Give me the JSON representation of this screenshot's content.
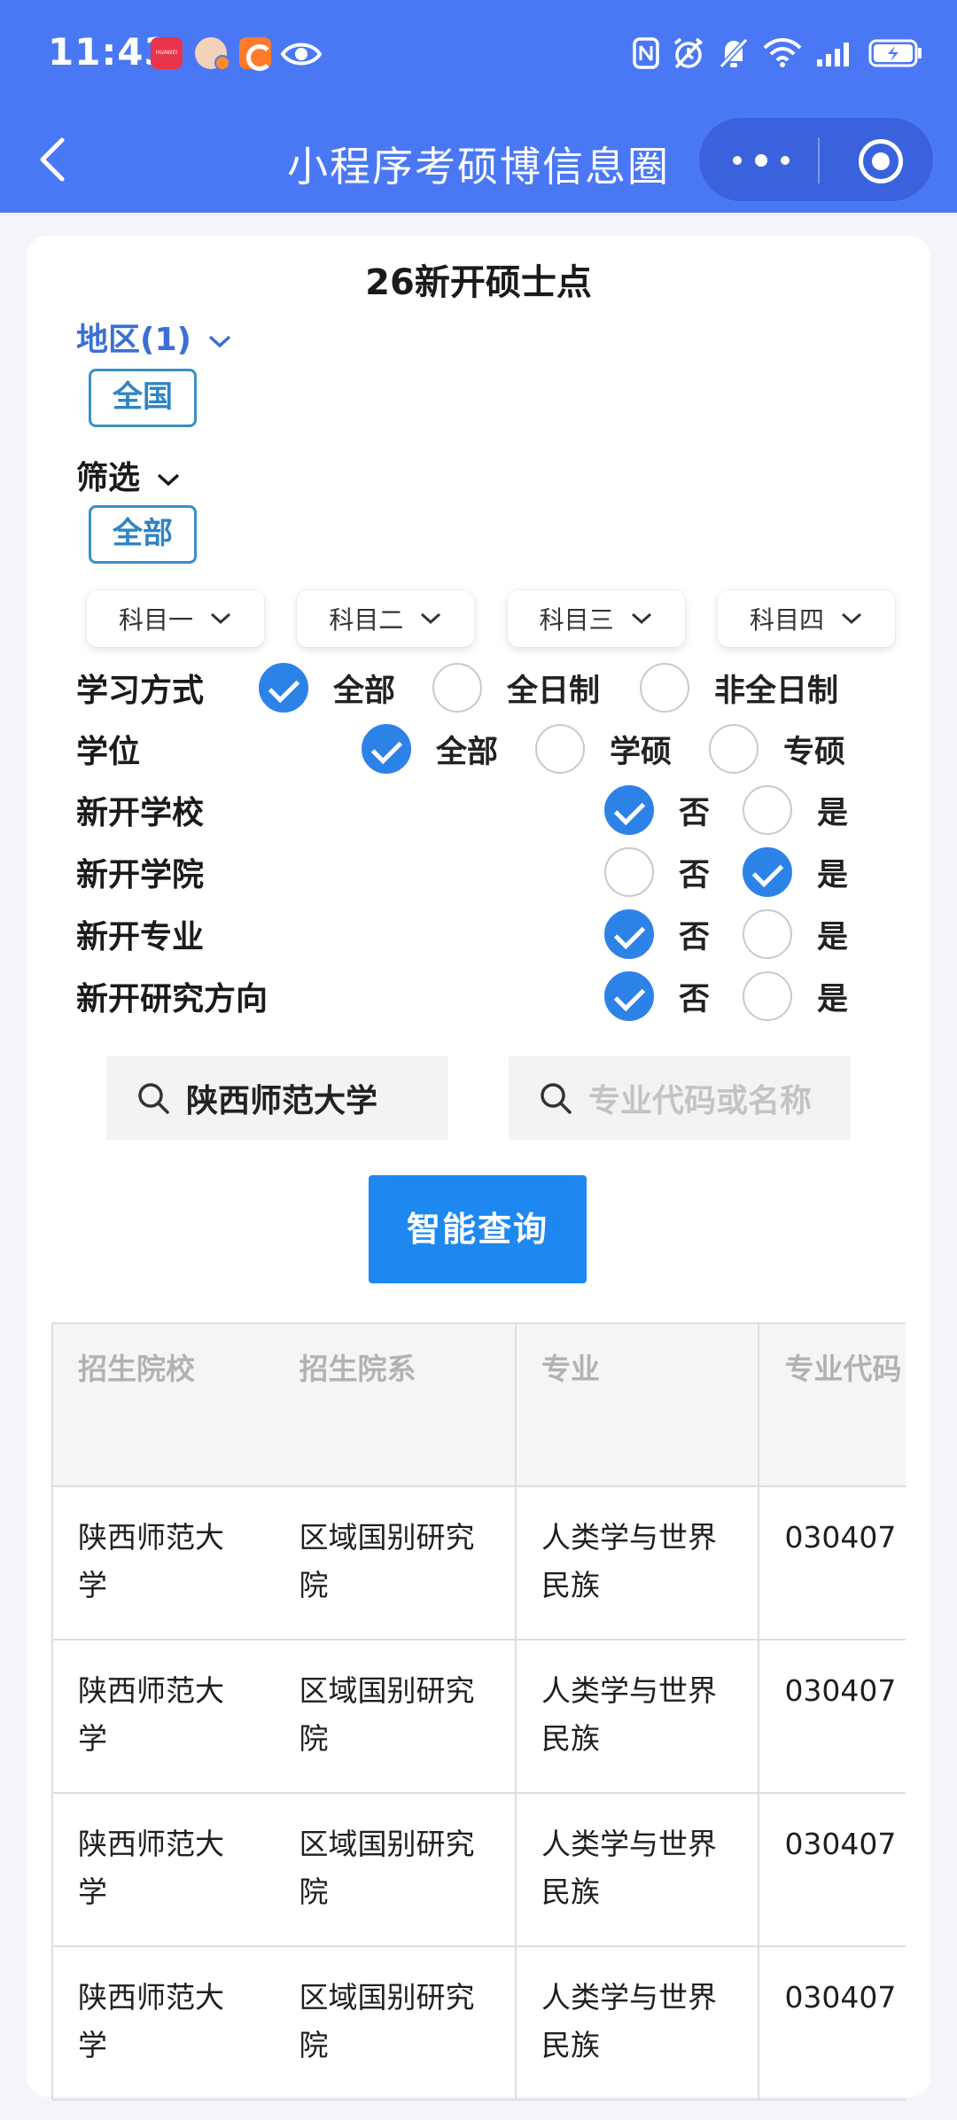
{
  "status_bar": {
    "time": "11:43",
    "huawei_badge": "HUAWEI"
  },
  "nav": {
    "title": "小程序考硕博信息圈"
  },
  "card": {
    "title": "26新开硕士点",
    "region_label": "地区(1)",
    "region_tag": "全国",
    "filter_label": "筛选",
    "filter_tag": "全部",
    "subjects": [
      "科目一",
      "科目二",
      "科目三",
      "科目四"
    ],
    "study_mode": {
      "label": "学习方式",
      "options": [
        "全部",
        "全日制",
        "非全日制"
      ],
      "selected": "全部"
    },
    "degree": {
      "label": "学位",
      "options": [
        "全部",
        "学硕",
        "专硕"
      ],
      "selected": "全部"
    },
    "new_school": {
      "label": "新开学校",
      "no": "否",
      "yes": "是",
      "selected": "否"
    },
    "new_college": {
      "label": "新开学院",
      "no": "否",
      "yes": "是",
      "selected": "是"
    },
    "new_major": {
      "label": "新开专业",
      "no": "否",
      "yes": "是",
      "selected": "否"
    },
    "new_direction": {
      "label": "新开研究方向",
      "no": "否",
      "yes": "是",
      "selected": "否"
    },
    "school_search_value": "陕西师范大学",
    "major_search_placeholder": "专业代码或名称",
    "query_button": "智能查询"
  },
  "table": {
    "headers": [
      "招生院校",
      "招生院系",
      "专业",
      "专业代码"
    ],
    "rows": [
      [
        "陕西师范大学",
        "区域国别研究院",
        "人类学与世界民族",
        "030407"
      ],
      [
        "陕西师范大学",
        "区域国别研究院",
        "人类学与世界民族",
        "030407"
      ],
      [
        "陕西师范大学",
        "区域国别研究院",
        "人类学与世界民族",
        "030407"
      ],
      [
        "陕西师范大学",
        "区域国别研究院",
        "人类学与世界民族",
        "030407"
      ]
    ]
  },
  "colors": {
    "header_bg": "#4a78f5",
    "accent_blue": "#2d82e8",
    "button_blue": "#1e88f0",
    "region_label": "#3b6fd8"
  }
}
